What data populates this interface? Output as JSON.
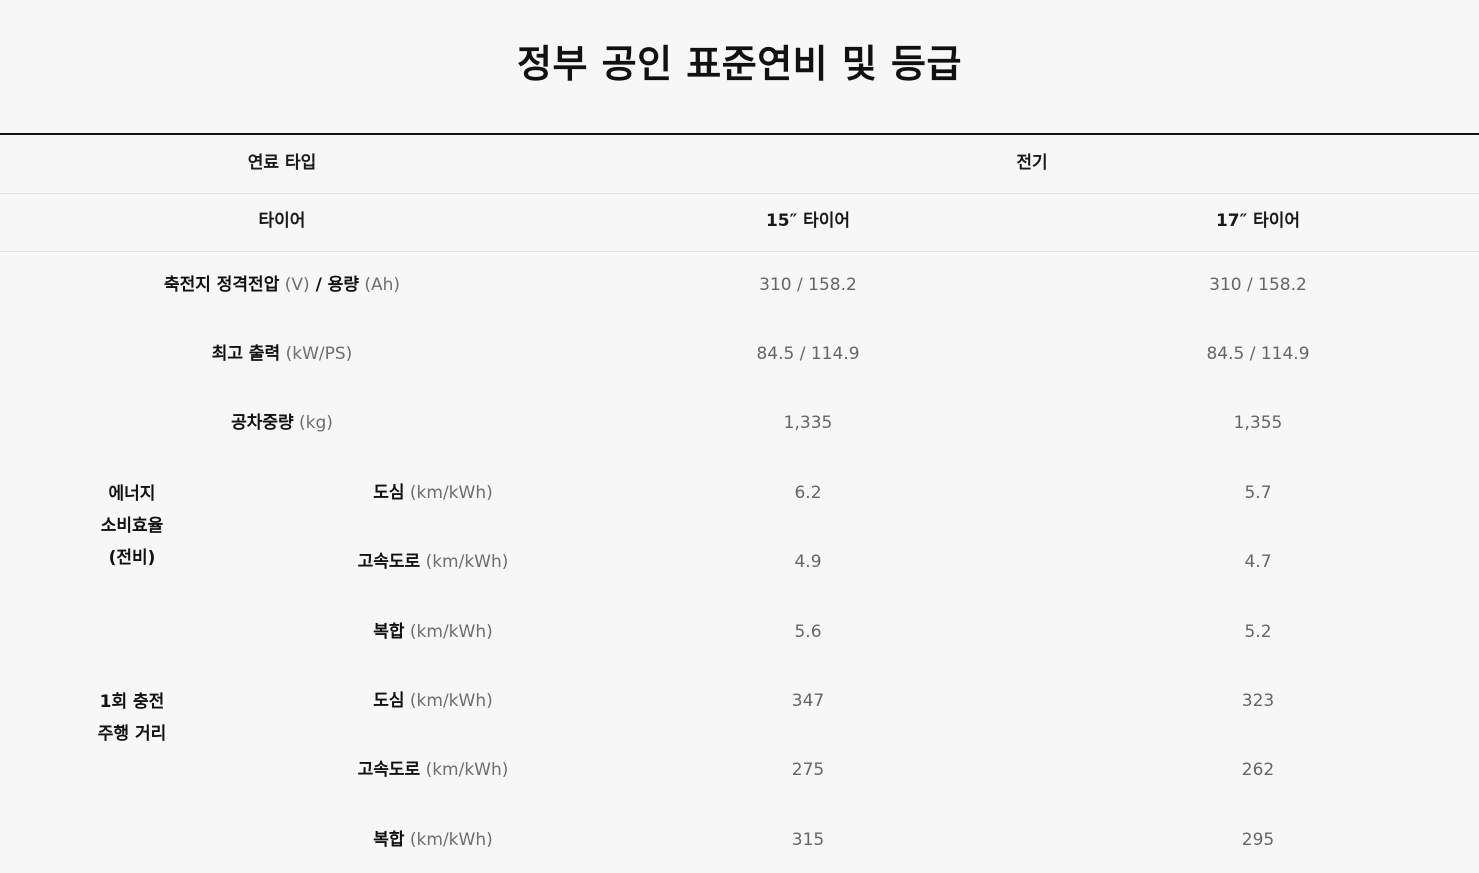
{
  "title": "정부 공인 표준연비 및 등급",
  "header": {
    "fuel_type_label": "연료 타입",
    "fuel_type_value": "전기",
    "tire_label": "타이어",
    "tire_15": "15″ 타이어",
    "tire_17": "17″ 타이어"
  },
  "rows": {
    "battery": {
      "label": "축전지 정격전압",
      "unit1": "(V)",
      "sep": " / ",
      "label2": "용량",
      "unit2": "(Ah)",
      "v15": "310 / 158.2",
      "v17": "310 / 158.2"
    },
    "power": {
      "label": "최고 출력",
      "unit": "(kW/PS)",
      "v15": "84.5 / 114.9",
      "v17": "84.5 / 114.9"
    },
    "weight": {
      "label": "공차중량",
      "unit": "(kg)",
      "v15": "1,335",
      "v17": "1,355"
    }
  },
  "efficiency": {
    "group_lines": [
      "에너지",
      "소비효율",
      "(전비)"
    ],
    "city": {
      "label": "도심",
      "unit": "(km/kWh)",
      "v15": "6.2",
      "v17": "5.7"
    },
    "highway": {
      "label": "고속도로",
      "unit": "(km/kWh)",
      "v15": "4.9",
      "v17": "4.7"
    },
    "combined": {
      "label": "복합",
      "unit": "(km/kWh)",
      "v15": "5.6",
      "v17": "5.2"
    }
  },
  "range": {
    "group_lines": [
      "1회 충전",
      "주행 거리"
    ],
    "city": {
      "label": "도심",
      "unit": "(km/kWh)",
      "v15": "347",
      "v17": "323"
    },
    "highway": {
      "label": "고속도로",
      "unit": "(km/kWh)",
      "v15": "275",
      "v17": "262"
    },
    "combined": {
      "label": "복합",
      "unit": "(km/kWh)",
      "v15": "315",
      "v17": "295"
    }
  }
}
